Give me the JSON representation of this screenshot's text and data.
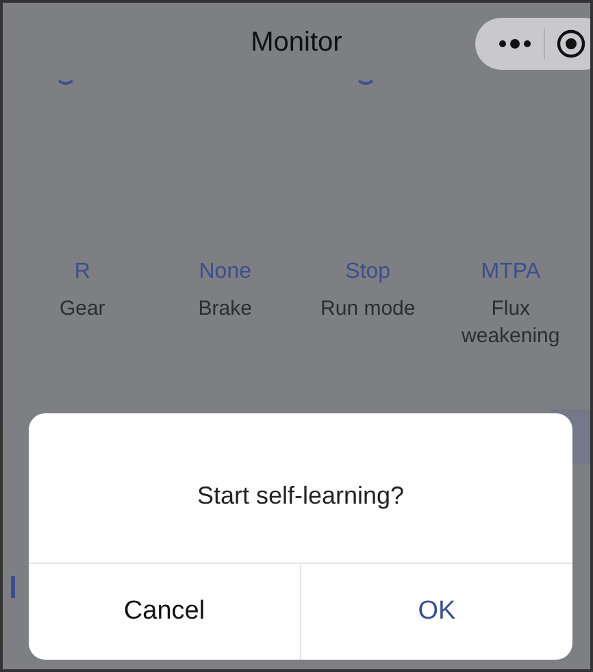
{
  "nav_bar": {
    "title": "Monitor"
  },
  "status_items": [
    {
      "value": "R",
      "label": "Gear"
    },
    {
      "value": "None",
      "label": "Brake"
    },
    {
      "value": "Stop",
      "label": "Run mode"
    },
    {
      "value": "MTPA",
      "label": "Flux weakening"
    }
  ],
  "dialog": {
    "message": "Start self-learning?",
    "buttons": [
      {
        "label": "Cancel",
        "kind": "cancel"
      },
      {
        "label": "OK",
        "kind": "confirm"
      }
    ]
  }
}
